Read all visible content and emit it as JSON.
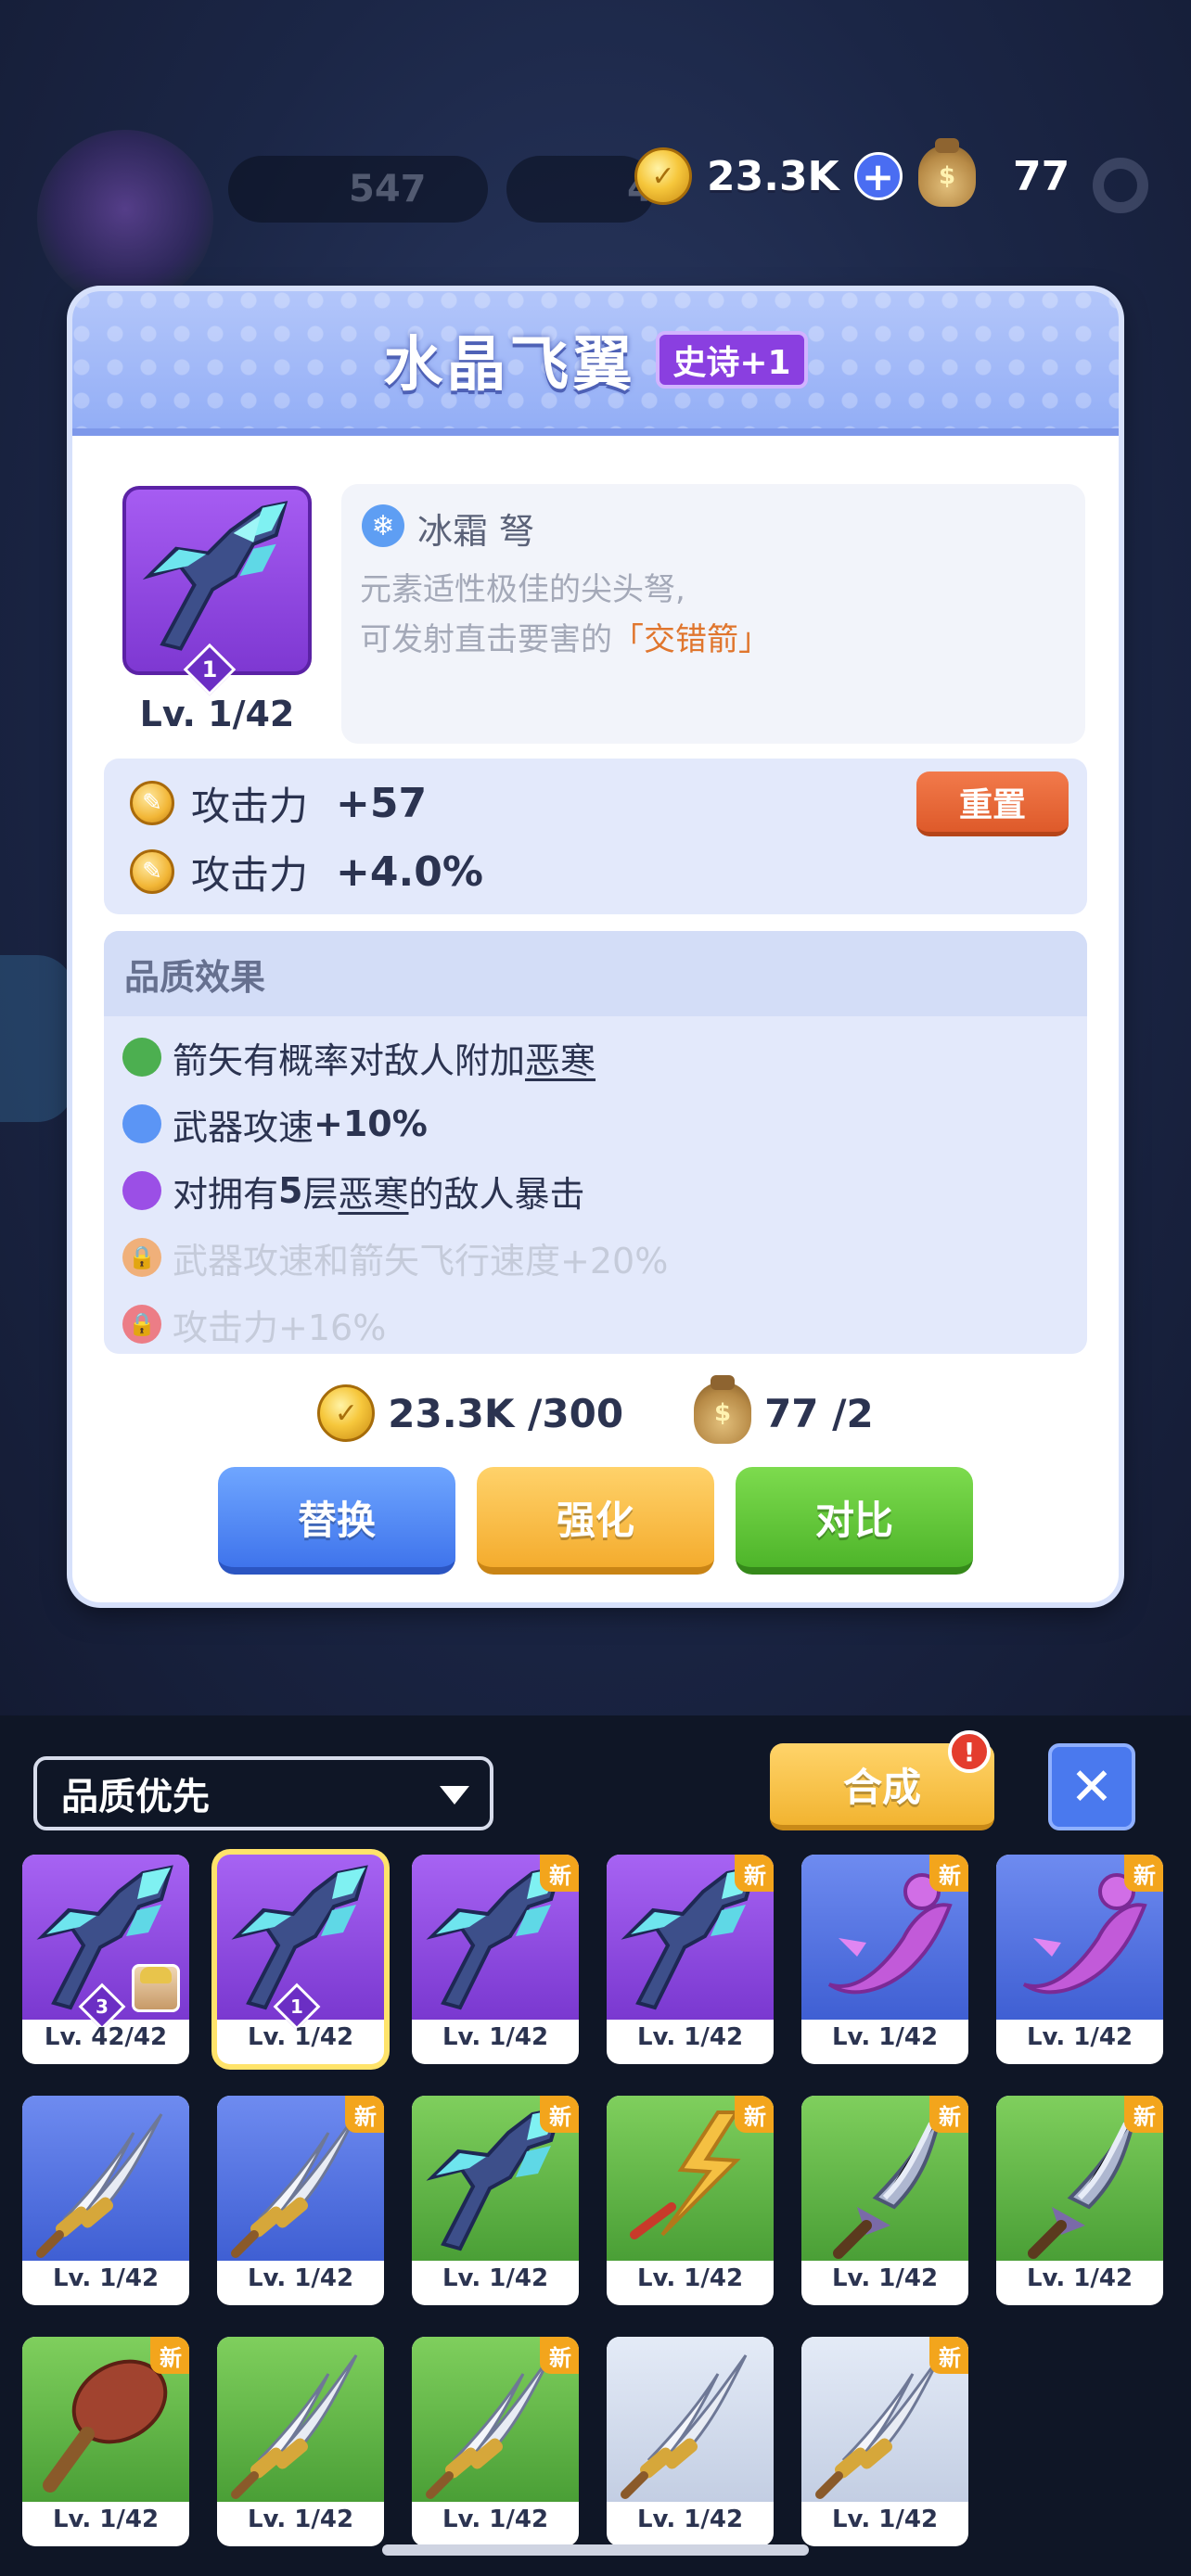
{
  "top_bar": {
    "bg_counter_1": "547",
    "bg_counter_2": "4",
    "coins": "23.3K",
    "bags": "77"
  },
  "modal": {
    "title": "水晶飞翼",
    "rarity": "史诗+1",
    "item_rank": "1",
    "item_level": "Lv. 1/42",
    "element_icon": "snowflake-icon",
    "item_type": "冰霜 弩",
    "desc_line1": "元素适性极佳的尖头弩,",
    "desc_line2_prefix": "可发射直击要害的",
    "desc_line2_highlight": "「交错箭」",
    "stats": [
      {
        "label": "攻击力",
        "value": "+57"
      },
      {
        "label": "攻击力",
        "value": "+4.0%"
      }
    ],
    "reset_label": "重置",
    "quality_title": "品质效果",
    "quality_effects": [
      {
        "pre": "箭矢有概率对敌人附加",
        "em": "恶寒",
        "post": "",
        "color": "#4caf50",
        "locked": false
      },
      {
        "pre": "武器攻速",
        "bold": "+10%",
        "color": "#5b95f5",
        "locked": false
      },
      {
        "pre": "对拥有",
        "bold": "5",
        "mid": "层",
        "em": "恶寒",
        "post": "的敌人暴击",
        "color": "#9b4fe6",
        "locked": false
      },
      {
        "text": "武器攻速和箭矢飞行速度+20%",
        "color": "#f0b07a",
        "locked": true
      },
      {
        "text": "攻击力+16%",
        "color": "#ec7d86",
        "locked": true
      }
    ],
    "cost_coins": "23.3K /300",
    "cost_bags": "77 /2",
    "btn_replace": "替换",
    "btn_enhance": "强化",
    "btn_compare": "对比"
  },
  "inventory": {
    "sort_label": "品质优先",
    "merge_label": "合成",
    "merge_alert": "!",
    "close_label": "✕",
    "new_tag": "新",
    "items": [
      {
        "level": "Lv. 42/42",
        "rank": "3",
        "art": "crossbow",
        "bg": "purple",
        "new": false,
        "hero": true
      },
      {
        "level": "Lv. 1/42",
        "rank": "1",
        "art": "crossbow",
        "bg": "purple",
        "new": false,
        "selected": true
      },
      {
        "level": "Lv. 1/42",
        "art": "crossbow",
        "bg": "purple",
        "new": true
      },
      {
        "level": "Lv. 1/42",
        "art": "crossbow",
        "bg": "purple",
        "new": true
      },
      {
        "level": "Lv. 1/42",
        "art": "dragon",
        "bg": "blue",
        "new": true
      },
      {
        "level": "Lv. 1/42",
        "art": "dragon",
        "bg": "blue",
        "new": true
      },
      {
        "level": "Lv. 1/42",
        "art": "daggers",
        "bg": "blue",
        "new": false
      },
      {
        "level": "Lv. 1/42",
        "art": "daggers",
        "bg": "blue",
        "new": true
      },
      {
        "level": "Lv. 1/42",
        "art": "crossbow",
        "bg": "green",
        "new": true
      },
      {
        "level": "Lv. 1/42",
        "art": "lightning",
        "bg": "green",
        "new": true
      },
      {
        "level": "Lv. 1/42",
        "art": "bigblade",
        "bg": "green",
        "new": true
      },
      {
        "level": "Lv. 1/42",
        "art": "bigblade",
        "bg": "green",
        "new": true
      },
      {
        "level": "Lv. 1/42",
        "art": "club",
        "bg": "green",
        "new": true
      },
      {
        "level": "Lv. 1/42",
        "art": "daggers",
        "bg": "green",
        "new": false
      },
      {
        "level": "Lv. 1/42",
        "art": "daggers",
        "bg": "green",
        "new": true
      },
      {
        "level": "Lv. 1/42",
        "art": "daggers",
        "bg": "white",
        "new": false
      },
      {
        "level": "Lv. 1/42",
        "art": "daggers",
        "bg": "white",
        "new": true
      }
    ]
  }
}
